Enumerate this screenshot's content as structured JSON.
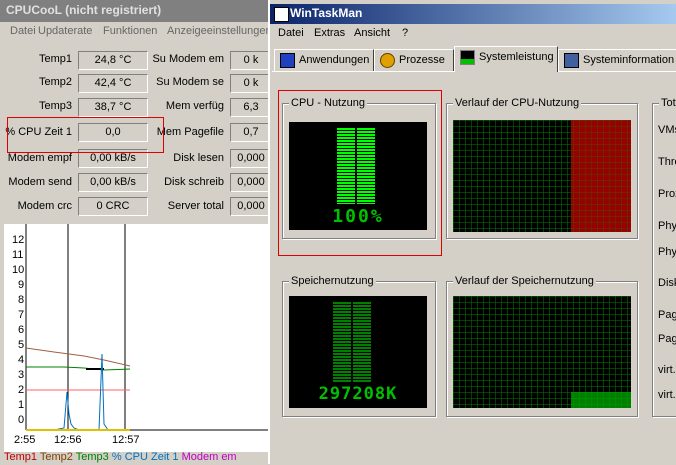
{
  "cpucool": {
    "title": "CPUCooL (nicht registriert)",
    "menu": [
      "Datei",
      "Updaterate",
      "Funktionen",
      "Anzeigeeinstellungen"
    ],
    "left_rows": [
      {
        "label": "Temp1",
        "value": "24,8 °C"
      },
      {
        "label": "Temp2",
        "value": "42,4 °C"
      },
      {
        "label": "Temp3",
        "value": "38,7 °C"
      },
      {
        "label": "% CPU Zeit 1",
        "value": "0,0"
      },
      {
        "label": "Modem empf",
        "value": "0,00 kB/s"
      },
      {
        "label": "Modem send",
        "value": "0,00 kB/s"
      },
      {
        "label": "Modem crc",
        "value": "0 CRC"
      }
    ],
    "right_rows": [
      {
        "label": "Su Modem em",
        "value": "0 k"
      },
      {
        "label": "Su Modem se",
        "value": "0 k"
      },
      {
        "label": "Mem verfüg",
        "value": "6,3"
      },
      {
        "label": "Mem Pagefile",
        "value": "0,7"
      },
      {
        "label": "Disk lesen",
        "value": "0,000"
      },
      {
        "label": "Disk schreib",
        "value": "0,000"
      },
      {
        "label": "Server total",
        "value": "0,000"
      }
    ],
    "graph": {
      "y_ticks": [
        "12",
        "11",
        "10",
        "9",
        "8",
        "7",
        "6",
        "5",
        "4",
        "3",
        "2",
        "1",
        "0"
      ],
      "x_ticks": [
        "2:55",
        "12:56",
        "12:57"
      ]
    },
    "legend": [
      {
        "text": "Temp1",
        "color": "#c00000"
      },
      {
        "text": "Temp2",
        "color": "#804000"
      },
      {
        "text": "Temp3",
        "color": "#008000"
      },
      {
        "text": "% CPU Zeit 1",
        "color": "#0070c0"
      },
      {
        "text": "Modem em",
        "color": "#c000c0"
      }
    ]
  },
  "wtm": {
    "title": "WinTaskMan",
    "menu": [
      "Datei",
      "Extras",
      "Ansicht",
      "?"
    ],
    "tabs": [
      "Anwendungen",
      "Prozesse",
      "Systemleistung",
      "Systeminformation"
    ],
    "active_tab": "Systemleistung",
    "cpu_usage": {
      "label": "CPU - Nutzung",
      "value_text": "100%",
      "level": 1.0
    },
    "cpu_history": {
      "label": "Verlauf der CPU-Nutzung"
    },
    "mem_usage": {
      "label": "Speichernutzung",
      "value_text": "297208K"
    },
    "mem_history": {
      "label": "Verlauf der Speichernutzung"
    },
    "right_group_label": "Tot",
    "right_labels": [
      "VMs",
      "Thre",
      "Proz",
      "Phy",
      "Phy",
      "Disk",
      "Pag",
      "Pag",
      "virt.",
      "virt."
    ]
  },
  "colors": {
    "meter_green": "#00ff00",
    "grid_green": "#008000",
    "history_red": "#c00000",
    "highlight_red": "#e00000"
  }
}
